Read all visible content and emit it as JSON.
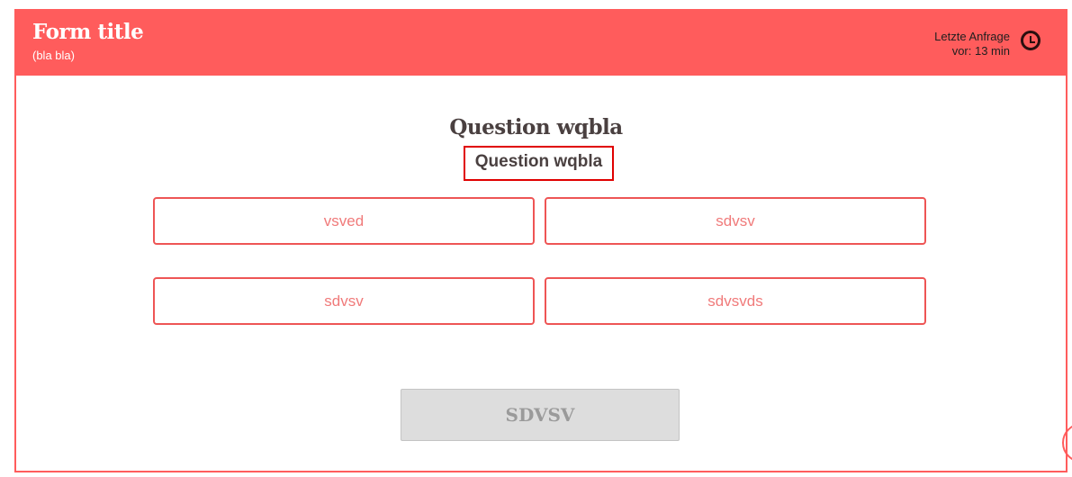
{
  "header": {
    "title": "Form title",
    "subtitle": "(bla bla)",
    "last_request_line1": "Letzte Anfrage",
    "last_request_line2": "vor: 13 min",
    "clock_icon": "clock-icon"
  },
  "question": {
    "title": "Question wqbla",
    "subtitle": "Question wqbla"
  },
  "answers": [
    {
      "label": "vsved"
    },
    {
      "label": "sdvsv"
    },
    {
      "label": "sdvsv"
    },
    {
      "label": "sdvsvds"
    }
  ],
  "submit": {
    "label": "SDVSV",
    "disabled": true
  },
  "colors": {
    "accent": "#ff5c5c",
    "highlight_border": "#e00000",
    "button_disabled": "#dddddd"
  }
}
